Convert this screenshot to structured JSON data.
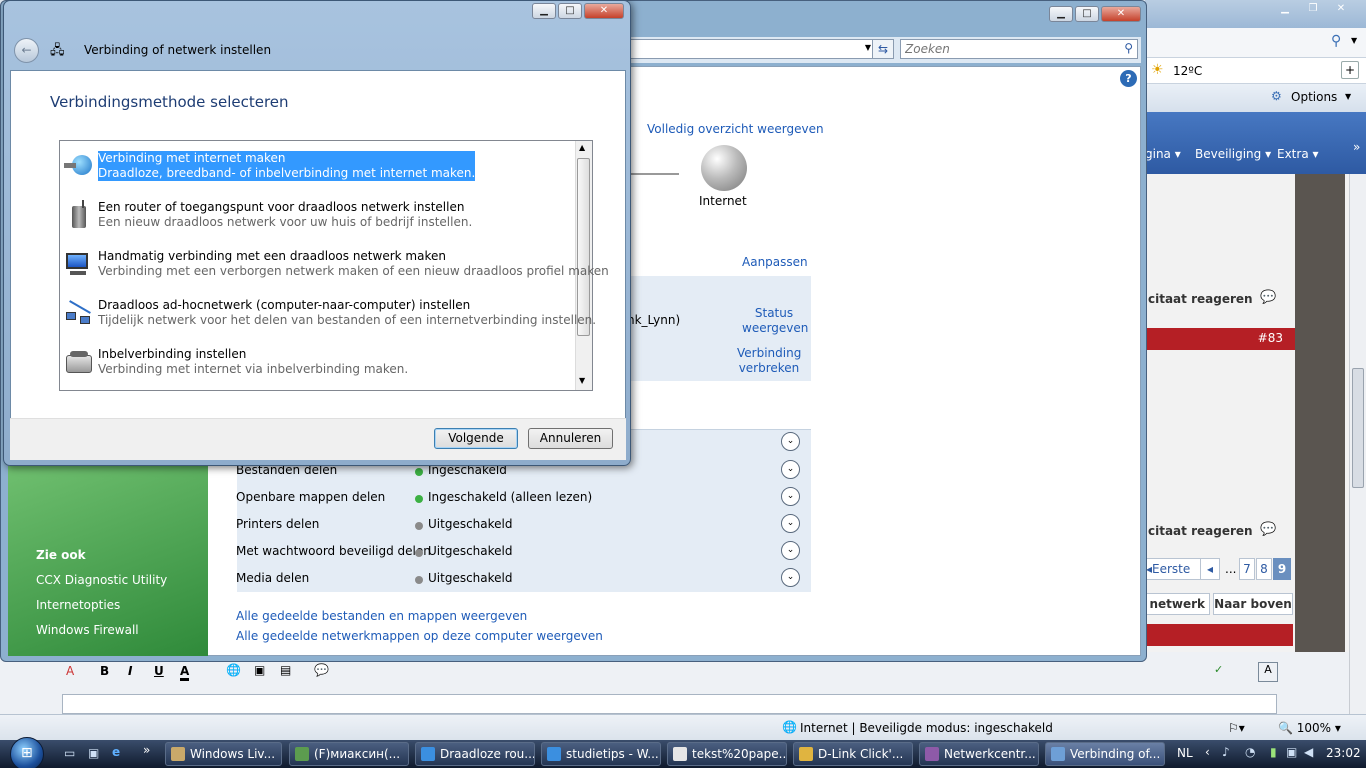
{
  "browser": {
    "weather": "12ºC",
    "options_label": "Options",
    "menus": [
      "gina",
      "Beveiliging",
      "Extra"
    ],
    "forum": {
      "quote_reply": "citaat reageren",
      "quote_reply2": "citaat reageren",
      "post_number": "#83",
      "pagination": {
        "first": "Eerste",
        "ellipsis": "...",
        "pages": [
          "7",
          "8",
          "9"
        ],
        "current": "9"
      },
      "network_btn": "netwerk",
      "top_btn": "Naar boven"
    },
    "status": {
      "zone": "Internet | Beveiligde modus: ingeschakeld",
      "zoom": "100%"
    }
  },
  "network_center": {
    "search_placeholder": "Zoeken",
    "full_view_link": "Volledig overzicht weergeven",
    "internet_label": "Internet",
    "customize_link": "Aanpassen",
    "network_name_fragment": "nk_Lynn)",
    "status_link": "Status weergeven",
    "disconnect_link": "Verbinding verbreken",
    "sharing_rows": [
      {
        "label": "Bestanden delen",
        "value": "Ingeschakeld",
        "state": "on"
      },
      {
        "label": "Openbare mappen delen",
        "value": "Ingeschakeld (alleen lezen)",
        "state": "on"
      },
      {
        "label": "Printers delen",
        "value": "Uitgeschakeld",
        "state": "off"
      },
      {
        "label": "Met wachtwoord beveiligd delen",
        "value": "Uitgeschakeld",
        "state": "off"
      },
      {
        "label": "Media delen",
        "value": "Uitgeschakeld",
        "state": "off"
      }
    ],
    "see_also": {
      "title": "Zie ook",
      "items": [
        "CCX Diagnostic Utility",
        "Internetopties",
        "Windows Firewall"
      ]
    },
    "bottom_links": [
      "Alle gedeelde bestanden en mappen weergeven",
      "Alle gedeelde netwerkmappen op deze computer weergeven"
    ]
  },
  "dialog": {
    "title": "Verbinding of netwerk instellen",
    "heading": "Verbindingsmethode selecteren",
    "options": [
      {
        "title": "Verbinding met internet maken",
        "desc": "Draadloze, breedband- of inbelverbinding met internet maken.",
        "icon": "globe-network-icon",
        "selected": true
      },
      {
        "title": "Een router of toegangspunt voor draadloos netwerk instellen",
        "desc": "Een nieuw draadloos netwerk voor uw huis of bedrijf instellen.",
        "icon": "router-icon",
        "selected": false
      },
      {
        "title": "Handmatig verbinding met een draadloos netwerk maken",
        "desc": "Verbinding met een verborgen netwerk maken of een nieuw draadloos profiel maken",
        "icon": "wireless-computer-icon",
        "selected": false
      },
      {
        "title": "Draadloos ad-hocnetwerk (computer-naar-computer) instellen",
        "desc": "Tijdelijk netwerk voor het delen van bestanden of een internetverbinding instellen.",
        "icon": "adhoc-network-icon",
        "selected": false
      },
      {
        "title": "Inbelverbinding instellen",
        "desc": "Verbinding met internet via inbelverbinding maken.",
        "icon": "dialup-phone-icon",
        "selected": false
      }
    ],
    "next_label": "Volgende",
    "cancel_label": "Annuleren"
  },
  "taskbar": {
    "tasks": [
      "Windows Liv...",
      "(F)миаксин(...",
      "Draadloze rou...",
      "studietips - W...",
      "tekst%20pape...",
      "D-Link Click'...",
      "Netwerkcentr...",
      "Verbinding of..."
    ],
    "active_index": 7,
    "language": "NL",
    "clock": "23:02"
  },
  "colors": {
    "selection": "#3399ff",
    "link": "#1e5bb8",
    "forum_red": "#b51f25",
    "green_dot": "#3cb043"
  }
}
